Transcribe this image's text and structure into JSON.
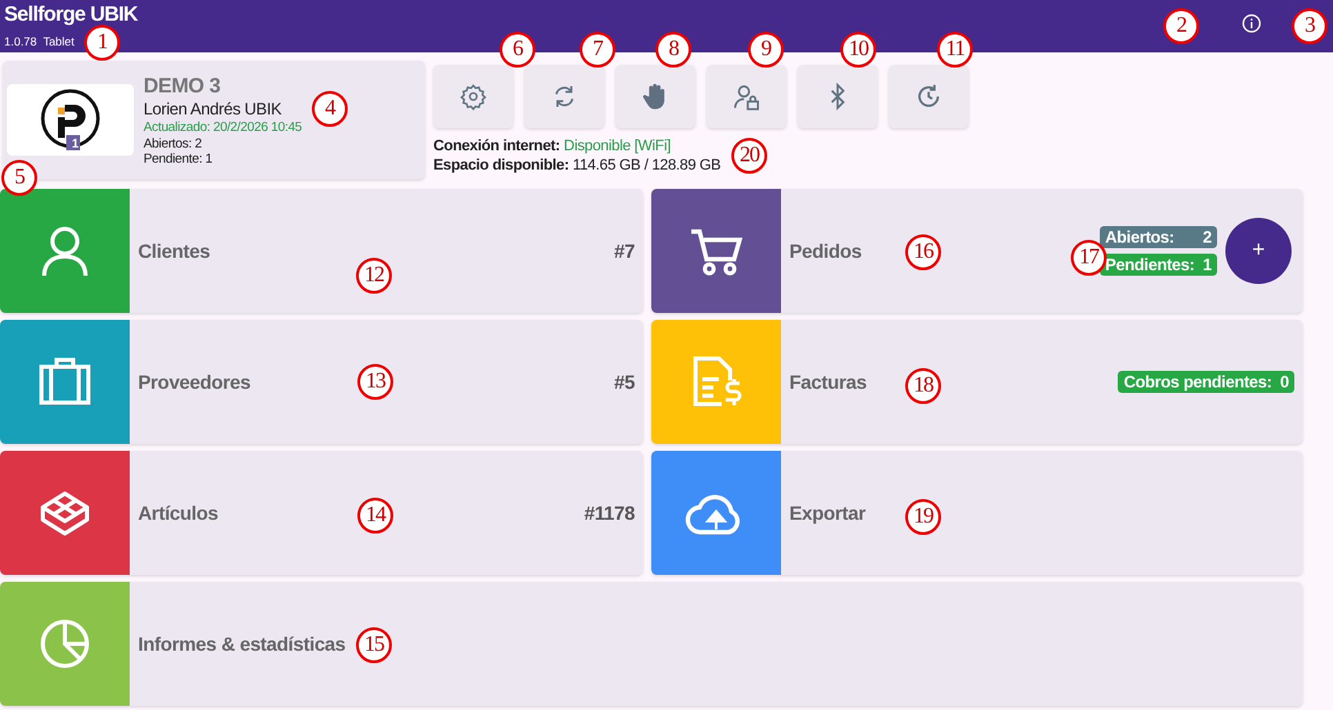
{
  "app_bar": {
    "title": "Sellforge UBIK",
    "subtitle": "1.0.78  Tablet"
  },
  "profile": {
    "company": "DEMO 3",
    "user": "Lorien Andrés UBIK",
    "updated": "Actualizado: 20/2/2026 10:45",
    "open": "Abiertos: 2",
    "pending": "Pendiente: 1",
    "logo_badge": "1"
  },
  "status": [
    {
      "label": "Conexión internet:",
      "value": "Disponible [WiFi]",
      "kind": "ok"
    },
    {
      "label": "Espacio disponible:",
      "value": "114.65 GB / 128.89 GB",
      "kind": "plain"
    }
  ],
  "tile_rows": [
    {
      "tiles": [
        {
          "label": "Clientes",
          "count": "#7",
          "color": "#27a844"
        },
        {
          "label": "Pedidos",
          "color": "#634f94",
          "badges": [
            {
              "label": "Abiertos:",
              "value": "2",
              "color": "#587a86"
            },
            {
              "label": "Pendientes:",
              "value": "1",
              "color": "#28a745"
            }
          ],
          "fab": "+"
        }
      ]
    },
    {
      "tiles": [
        {
          "label": "Proveedores",
          "count": "#5",
          "color": "#17a0b8"
        },
        {
          "label": "Facturas",
          "color": "#fec107",
          "badges": [
            {
              "label": "Cobros pendientes:",
              "value": "0",
              "color": "#28a745"
            }
          ]
        }
      ]
    },
    {
      "tiles": [
        {
          "label": "Artículos",
          "count": "#1178",
          "color": "#dc3545"
        },
        {
          "label": "Exportar",
          "color": "#3f8ef7"
        }
      ]
    },
    {
      "tiles": [
        {
          "label": "Informes & estadísticas",
          "color": "#8bc34a",
          "wide": true
        }
      ]
    }
  ],
  "callouts": [
    "1",
    "2",
    "3",
    "4",
    "5",
    "6",
    "7",
    "8",
    "9",
    "10",
    "11",
    "12",
    "13",
    "14",
    "15",
    "16",
    "17",
    "18",
    "19",
    "20"
  ]
}
